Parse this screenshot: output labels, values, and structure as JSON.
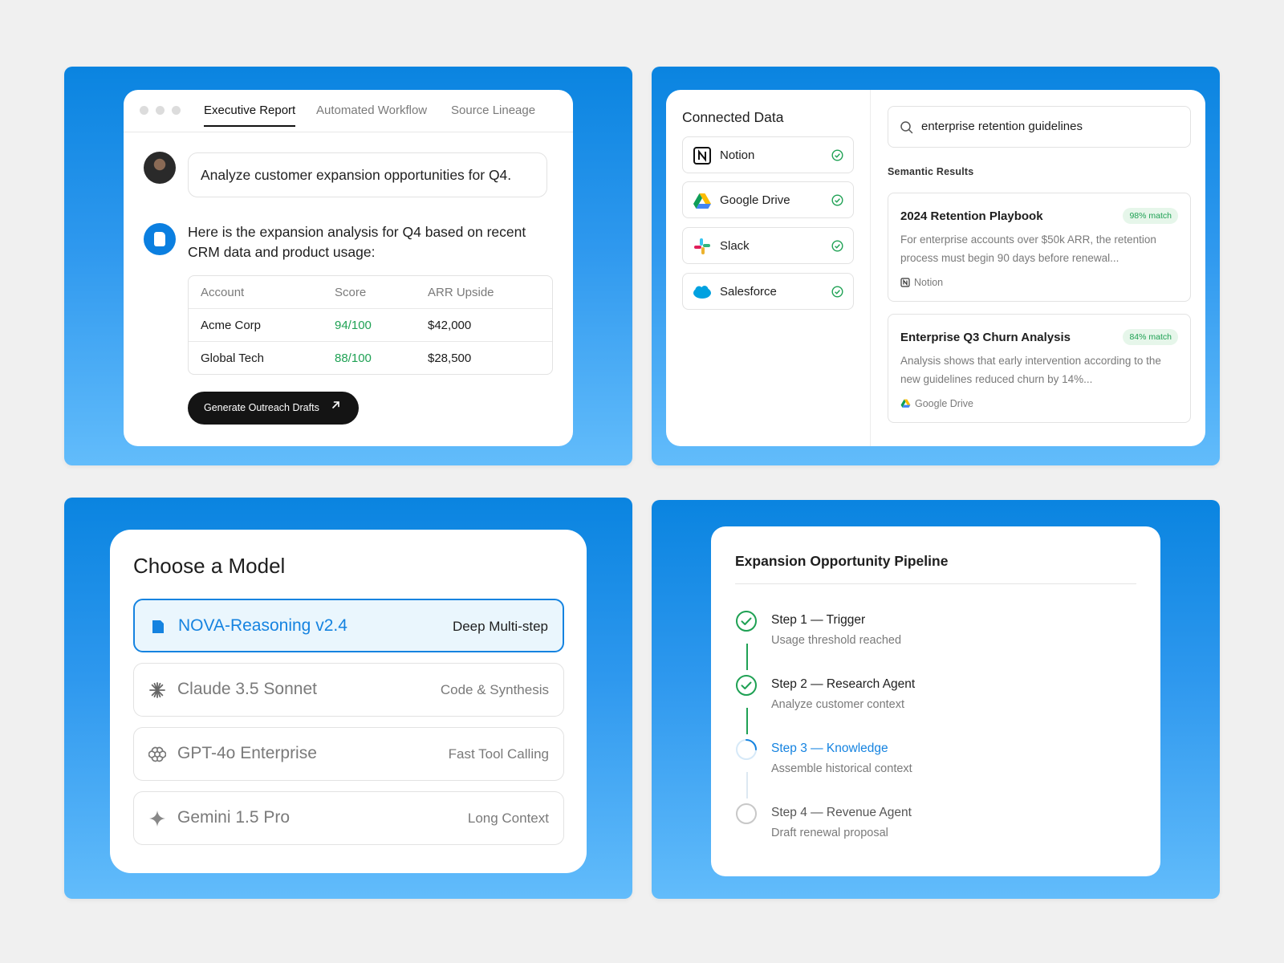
{
  "executive_report": {
    "tabs": [
      "Executive Report",
      "Automated Workflow",
      "Source Lineage"
    ],
    "active_tab": "Executive Report",
    "user_prompt": "Analyze customer expansion opportunities for Q4.",
    "assistant_answer": "Here is the expansion analysis for Q4 based on recent CRM data and product usage:",
    "table": {
      "headers": [
        "Account",
        "Score",
        "ARR Upside"
      ],
      "rows": [
        [
          "Acme Corp",
          "94/100",
          "$42,000"
        ],
        [
          "Global Tech",
          "88/100",
          "$28,500"
        ]
      ]
    },
    "cta_label": "Generate Outreach Drafts",
    "cta_icon": "arrow-up-right-icon"
  },
  "connected_data": {
    "title": "Connected Data",
    "sources": [
      {
        "name": "Notion",
        "icon": "notion-icon",
        "status": "connected"
      },
      {
        "name": "Google Drive",
        "icon": "google-drive-icon",
        "status": "connected"
      },
      {
        "name": "Slack",
        "icon": "slack-icon",
        "status": "connected"
      },
      {
        "name": "Salesforce",
        "icon": "salesforce-icon",
        "status": "connected"
      }
    ],
    "search_query": "enterprise retention guidelines",
    "results_label": "Semantic Results",
    "results": [
      {
        "title": "2024 Retention Playbook",
        "match": "98% match",
        "snippet": "For enterprise accounts over $50k ARR, the retention process must begin 90 days before renewal...",
        "source": "Notion"
      },
      {
        "title": "Enterprise Q3 Churn Analysis",
        "match": "84% match",
        "snippet": "Analysis shows that early intervention according to the new guidelines reduced churn by 14%...",
        "source": "Google Drive"
      }
    ]
  },
  "model_picker": {
    "title": "Choose a Model",
    "models": [
      {
        "name": "NOVA-Reasoning v2.4",
        "tag": "Deep Multi-step",
        "icon": "nova-icon",
        "selected": true
      },
      {
        "name": "Claude 3.5 Sonnet",
        "tag": "Code & Synthesis",
        "icon": "claude-icon",
        "selected": false
      },
      {
        "name": "GPT-4o Enterprise",
        "tag": "Fast Tool Calling",
        "icon": "openai-icon",
        "selected": false
      },
      {
        "name": "Gemini 1.5 Pro",
        "tag": "Long Context",
        "icon": "gemini-icon",
        "selected": false
      }
    ]
  },
  "pipeline": {
    "title": "Expansion Opportunity Pipeline",
    "steps": [
      {
        "title": "Step 1 — Trigger",
        "desc": "Usage threshold reached",
        "status": "complete"
      },
      {
        "title": "Step 2 — Research Agent",
        "desc": "Analyze customer context",
        "status": "complete"
      },
      {
        "title": "Step 3 — Knowledge",
        "desc": "Assemble historical context",
        "status": "in-progress"
      },
      {
        "title": "Step 4 — Revenue Agent",
        "desc": "Draft renewal proposal",
        "status": "pending"
      }
    ]
  },
  "colors": {
    "accent_blue": "#1583e0",
    "success_green": "#1fa154",
    "panel_gradient_top": "#0a84e0",
    "panel_gradient_bottom": "#62bcfb",
    "dark_button": "#141414"
  }
}
